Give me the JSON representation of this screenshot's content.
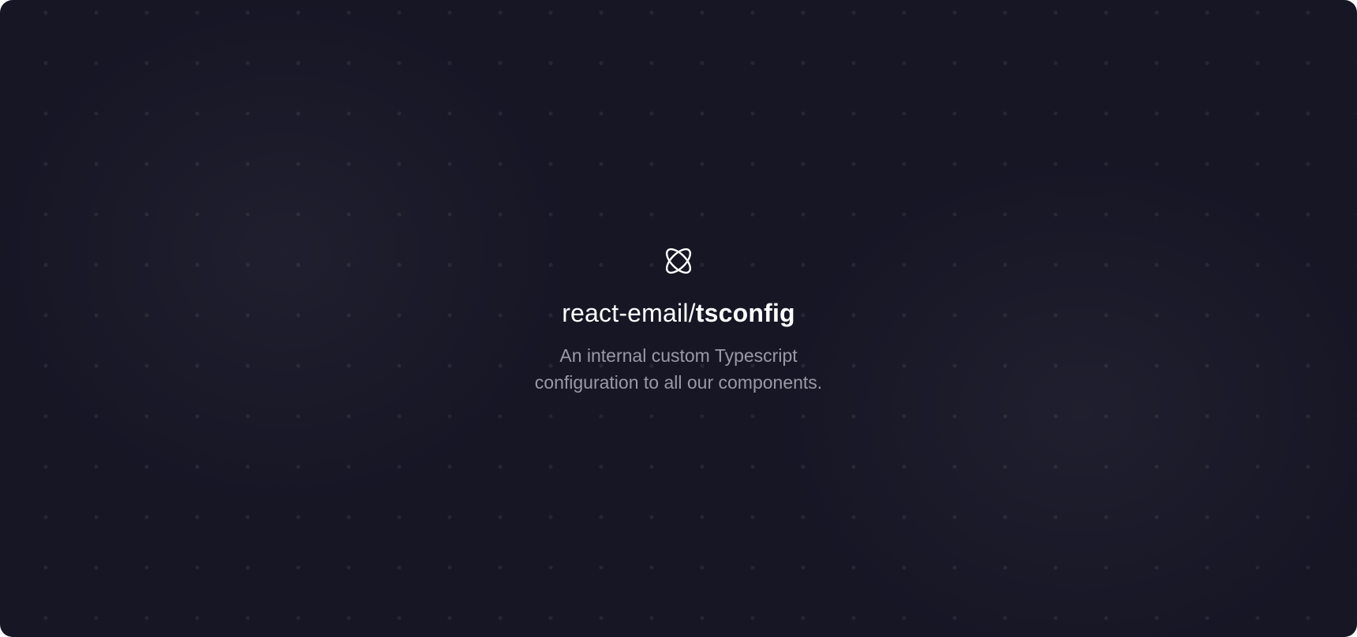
{
  "brand": {
    "icon": "atom-icon",
    "accent_color": "#ffffff",
    "background_color": "#161625"
  },
  "hero": {
    "title_prefix": "react-email/",
    "title_emphasis": "tsconfig",
    "description_line_1": "An internal custom Typescript",
    "description_line_2": "configuration to all our components."
  }
}
